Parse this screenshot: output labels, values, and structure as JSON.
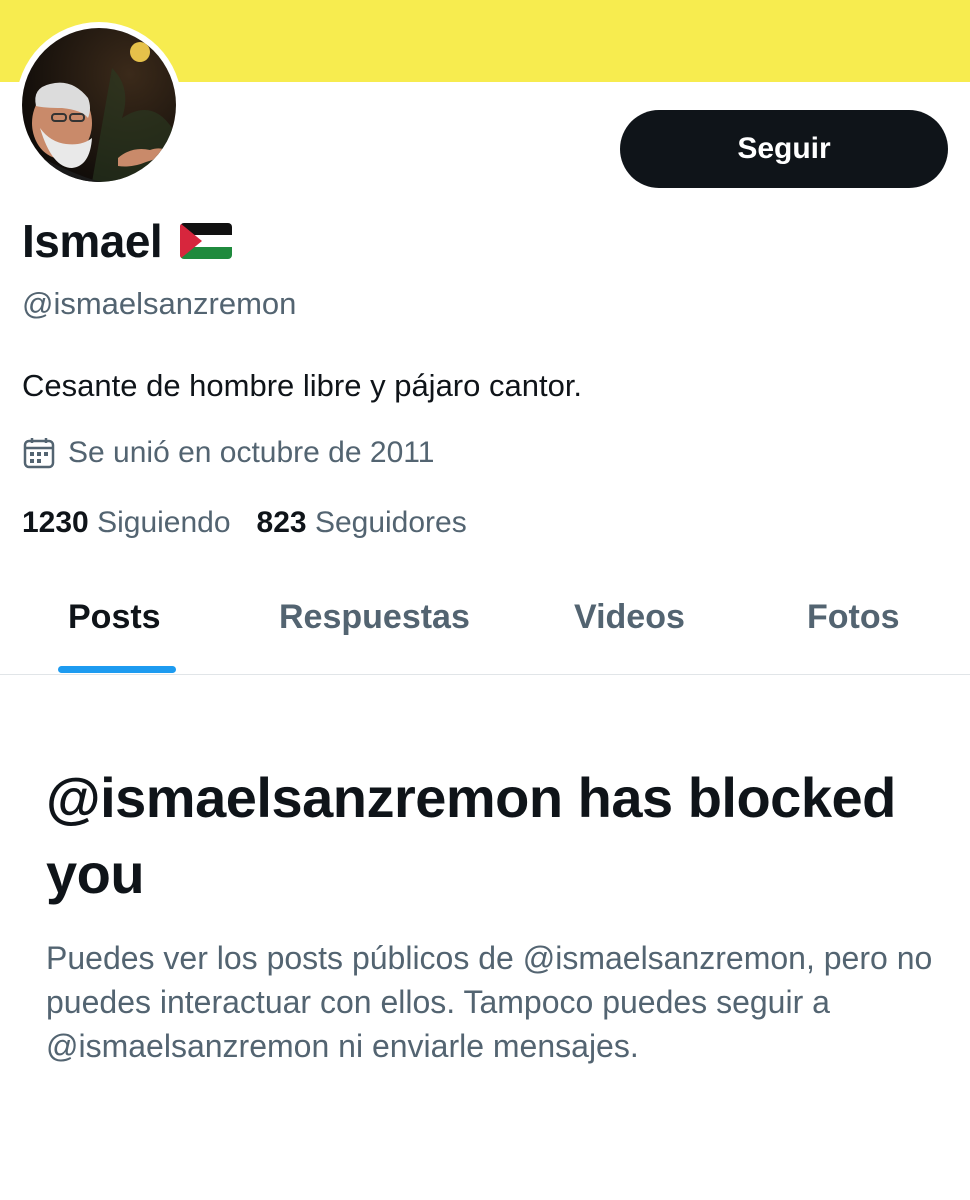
{
  "profile": {
    "banner_color": "#f7ec4f",
    "avatar_alt": "profile photo",
    "display_name": "Ismael",
    "flag_icon": "palestine-flag-icon",
    "handle": "@ismaelsanzremon",
    "bio": "Cesante de hombre libre y pájaro cantor.",
    "joined": "Se unió en octubre de 2011",
    "joined_icon": "calendar-icon",
    "following_count": "1230",
    "following_label": "Siguiendo",
    "followers_count": "823",
    "followers_label": "Seguidores"
  },
  "actions": {
    "follow_label": "Seguir"
  },
  "tabs": [
    {
      "label": "Posts",
      "active": true
    },
    {
      "label": "Respuestas",
      "active": false
    },
    {
      "label": "Videos",
      "active": false
    },
    {
      "label": "Fotos",
      "active": false
    }
  ],
  "blocked": {
    "title": "@ismaelsanzremon has blocked you",
    "description": "Puedes ver los posts públicos de @ismaelsanzremon, pero no puedes interactuar con ellos. Tampoco puedes seguir a @ismaelsanzremon ni enviarle mensajes."
  },
  "colors": {
    "text_primary": "#0f1419",
    "text_secondary": "#536471",
    "accent": "#1d9bf0",
    "button_bg": "#0f1419"
  }
}
